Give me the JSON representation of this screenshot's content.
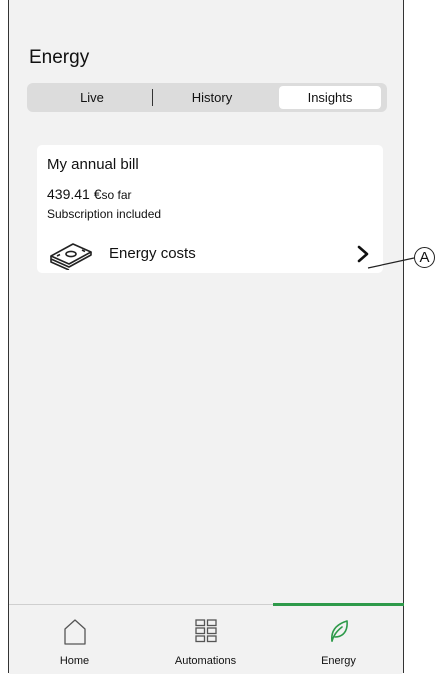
{
  "page": {
    "title": "Energy"
  },
  "tabs_segment": [
    {
      "label": "Live"
    },
    {
      "label": "History"
    },
    {
      "label": "Insights",
      "selected": true
    }
  ],
  "card": {
    "title": "My annual bill",
    "amount": "439.41 €",
    "amount_suffix": "so far",
    "subtitle": "Subscription included",
    "costs_label": "Energy costs",
    "icon": "money-stack-icon"
  },
  "callout": {
    "label": "A"
  },
  "tabbar": {
    "active": "energy",
    "accent": "#2e9a4a",
    "items": [
      {
        "label": "Home",
        "icon": "home-icon"
      },
      {
        "label": "Automations",
        "icon": "grid-icon"
      },
      {
        "label": "Energy",
        "icon": "leaf-icon"
      }
    ]
  }
}
